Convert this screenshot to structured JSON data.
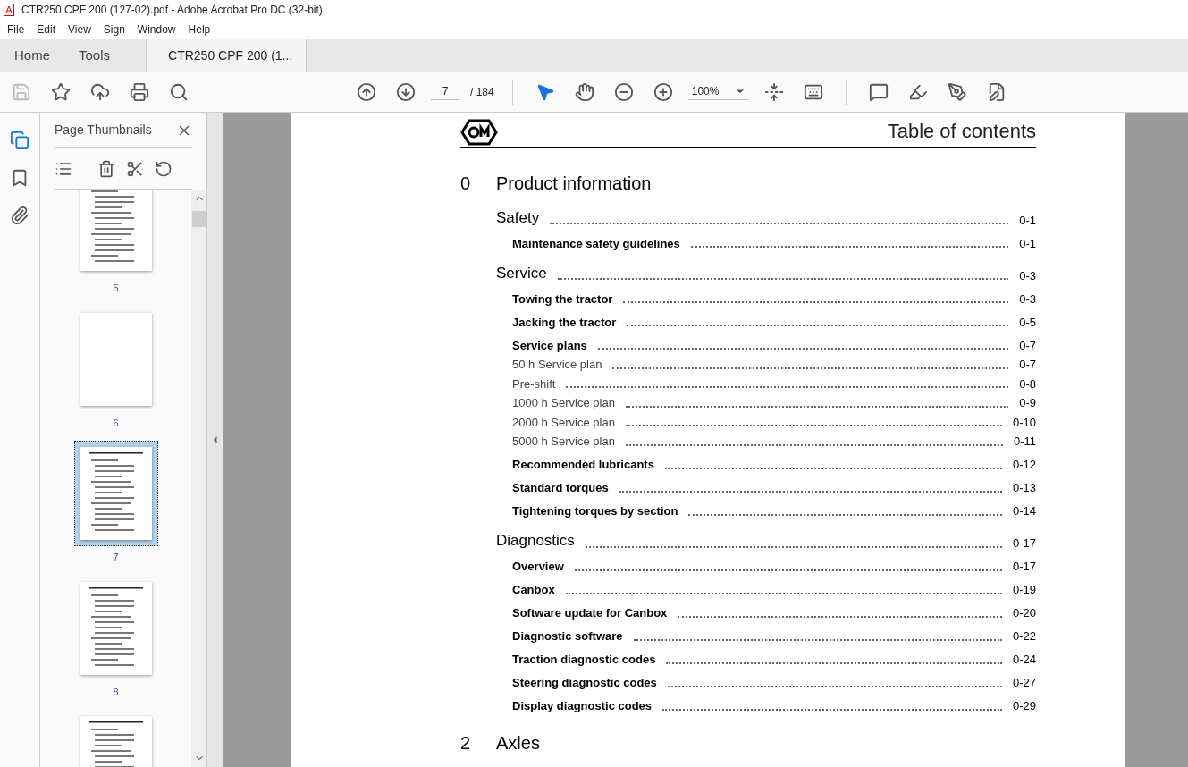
{
  "window": {
    "title": "CTR250 CPF 200 (127-02).pdf - Adobe Acrobat Pro DC (32-bit)"
  },
  "menu": [
    "File",
    "Edit",
    "View",
    "Sign",
    "Window",
    "Help"
  ],
  "tabs": [
    {
      "label": "Home",
      "selected": false,
      "kind": "nav"
    },
    {
      "label": "Tools",
      "selected": false,
      "kind": "nav"
    },
    {
      "label": "CTR250 CPF 200 (1...",
      "selected": true,
      "kind": "document"
    }
  ],
  "toolbar": {
    "save_disabled": true,
    "page": "7",
    "page_total": "/ 184",
    "zoom": "100%"
  },
  "sidebar": {
    "title": "Page Thumbnails",
    "thumbnails": [
      {
        "label": "5",
        "selected": false,
        "kind": "text"
      },
      {
        "label": "6",
        "selected": false,
        "kind": "blank"
      },
      {
        "label": "7",
        "selected": true,
        "kind": "text"
      },
      {
        "label": "8",
        "selected": false,
        "kind": "text"
      },
      {
        "selected": false,
        "kind": "text"
      }
    ]
  },
  "document": {
    "header": "Table of contents",
    "entries": [
      {
        "kind": "chapter",
        "number": "0",
        "title": "Product information"
      },
      {
        "kind": "topic",
        "title": "Safety",
        "page": "0-1"
      },
      {
        "kind": "item",
        "title": "Maintenance safety guidelines",
        "page": "0-1"
      },
      {
        "kind": "topic",
        "title": "Service",
        "page": "0-3"
      },
      {
        "kind": "item",
        "title": "Towing the tractor",
        "page": "0-3"
      },
      {
        "kind": "item",
        "title": "Jacking the tractor",
        "page": "0-5"
      },
      {
        "kind": "item",
        "title": "Service plans",
        "page": "0-7"
      },
      {
        "kind": "subitem",
        "title": "50 h Service plan",
        "page": "0-7"
      },
      {
        "kind": "subitem",
        "title": "Pre-shift",
        "page": "0-8"
      },
      {
        "kind": "subitem",
        "title": "1000 h Service plan",
        "page": "0-9"
      },
      {
        "kind": "subitem",
        "title": "2000 h Service plan",
        "page": "0-10"
      },
      {
        "kind": "subitem",
        "title": "5000 h Service plan",
        "page": "0-11"
      },
      {
        "kind": "item",
        "title": "Recommended lubricants",
        "page": "0-12"
      },
      {
        "kind": "item",
        "title": "Standard torques",
        "page": "0-13"
      },
      {
        "kind": "item",
        "title": "Tightening torques by section",
        "page": "0-14"
      },
      {
        "kind": "topic",
        "title": "Diagnostics",
        "page": "0-17"
      },
      {
        "kind": "item",
        "title": "Overview",
        "page": "0-17"
      },
      {
        "kind": "item",
        "title": "Canbox",
        "page": "0-19"
      },
      {
        "kind": "item",
        "title": "Software update for Canbox",
        "page": "0-20"
      },
      {
        "kind": "item",
        "title": "Diagnostic software",
        "page": "0-22"
      },
      {
        "kind": "item",
        "title": "Traction diagnostic codes",
        "page": "0-24"
      },
      {
        "kind": "item",
        "title": "Steering diagnostic codes",
        "page": "0-27"
      },
      {
        "kind": "item",
        "title": "Display diagnostic codes",
        "page": "0-29"
      },
      {
        "kind": "chapter",
        "number": "2",
        "title": "Axles"
      }
    ]
  }
}
